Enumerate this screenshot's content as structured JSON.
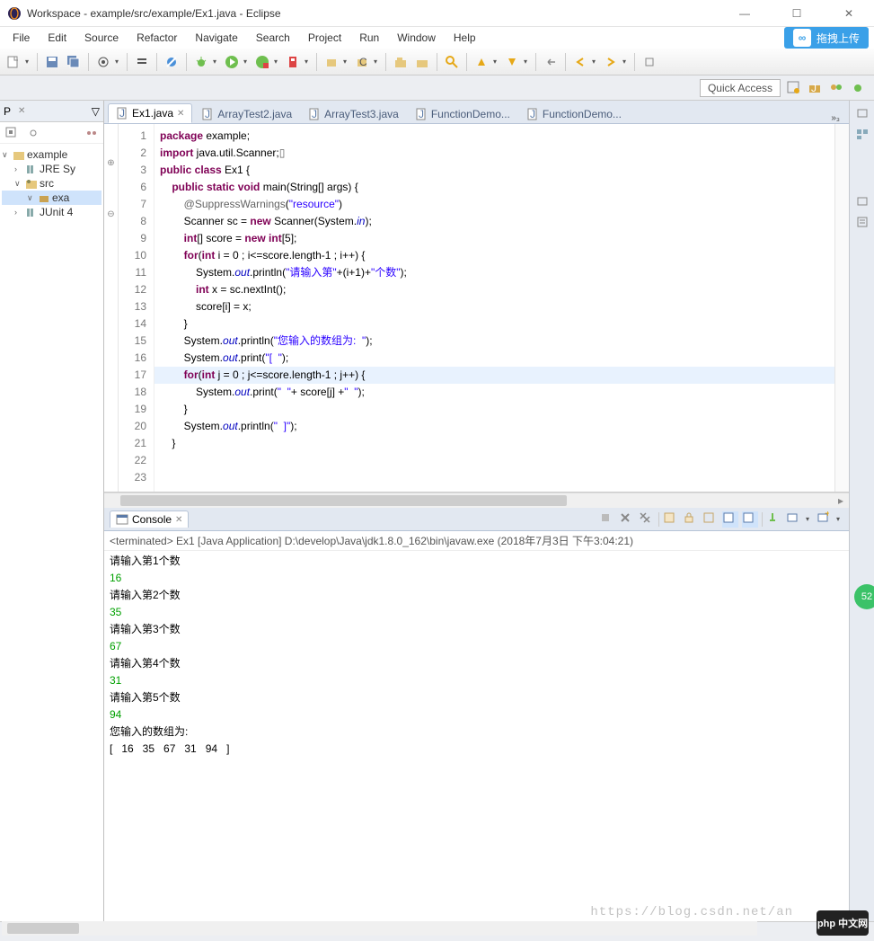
{
  "window": {
    "title": "Workspace - example/src/example/Ex1.java - Eclipse"
  },
  "menu": [
    "File",
    "Edit",
    "Source",
    "Refactor",
    "Navigate",
    "Search",
    "Project",
    "Run",
    "Window",
    "Help"
  ],
  "upload_label": "拖拽上传",
  "quick_access": "Quick Access",
  "sidebar": {
    "tab_label": "P",
    "tree": {
      "root": "example",
      "jre": "JRE Sy",
      "src": "src",
      "pkg": "exa",
      "junit": "JUnit 4"
    }
  },
  "editor": {
    "tabs": [
      {
        "label": "Ex1.java",
        "active": true,
        "close": true
      },
      {
        "label": "ArrayTest2.java",
        "active": false
      },
      {
        "label": "ArrayTest3.java",
        "active": false
      },
      {
        "label": "FunctionDemo...",
        "active": false
      },
      {
        "label": "FunctionDemo...",
        "active": false
      }
    ],
    "overflow": "»₃",
    "highlight_line": 17,
    "lines": [
      {
        "n": 1,
        "t": [
          [
            "kw",
            "package"
          ],
          [
            "",
            " example;"
          ]
        ]
      },
      {
        "n": 2,
        "t": [
          [
            "",
            ""
          ]
        ]
      },
      {
        "n": 3,
        "mk": "⊕",
        "t": [
          [
            "kw",
            "import"
          ],
          [
            "",
            " java.util.Scanner;"
          ],
          [
            "cm",
            "▯"
          ]
        ]
      },
      {
        "n": 6,
        "t": [
          [
            "",
            ""
          ]
        ]
      },
      {
        "n": 7,
        "t": [
          [
            "kw",
            "public class"
          ],
          [
            "",
            " Ex1 {"
          ]
        ]
      },
      {
        "n": 8,
        "mk": "⊖",
        "t": [
          [
            "",
            "    "
          ],
          [
            "kw",
            "public static void"
          ],
          [
            "",
            " main(String[] args) {"
          ]
        ]
      },
      {
        "n": 9,
        "t": [
          [
            "",
            "        "
          ],
          [
            "ann",
            "@SuppressWarnings"
          ],
          [
            "",
            "("
          ],
          [
            "str",
            "\"resource\""
          ],
          [
            "",
            ")"
          ]
        ]
      },
      {
        "n": 10,
        "t": [
          [
            "",
            "        Scanner sc = "
          ],
          [
            "kw",
            "new"
          ],
          [
            "",
            " Scanner(System."
          ],
          [
            "fld",
            "in"
          ],
          [
            "",
            ");"
          ]
        ]
      },
      {
        "n": 11,
        "t": [
          [
            "",
            "        "
          ],
          [
            "kw",
            "int"
          ],
          [
            "",
            "[] score = "
          ],
          [
            "kw",
            "new int"
          ],
          [
            "",
            "[5];"
          ]
        ]
      },
      {
        "n": 12,
        "t": [
          [
            "",
            "        "
          ],
          [
            "kw",
            "for"
          ],
          [
            "",
            "("
          ],
          [
            "kw",
            "int"
          ],
          [
            "",
            " i = 0 ; i<=score.length-1 ; i++) {"
          ]
        ]
      },
      {
        "n": 13,
        "t": [
          [
            "",
            "            System."
          ],
          [
            "fld",
            "out"
          ],
          [
            "",
            ".println("
          ],
          [
            "str",
            "\"请输入第\""
          ],
          [
            "",
            "+(i+1)+"
          ],
          [
            "str",
            "\"个数\""
          ],
          [
            "",
            ");"
          ]
        ]
      },
      {
        "n": 14,
        "t": [
          [
            "",
            "            "
          ],
          [
            "kw",
            "int"
          ],
          [
            "",
            " x = sc.nextInt();"
          ]
        ]
      },
      {
        "n": 15,
        "t": [
          [
            "",
            "            score[i] = x;"
          ]
        ]
      },
      {
        "n": 16,
        "t": [
          [
            "",
            "        }"
          ]
        ]
      },
      {
        "n": 17,
        "t": [
          [
            "",
            "        System."
          ],
          [
            "fld",
            "out"
          ],
          [
            "",
            ".println("
          ],
          [
            "str",
            "\"您输入的数组为:  \""
          ],
          [
            "",
            ");"
          ]
        ]
      },
      {
        "n": 18,
        "t": [
          [
            "",
            "        System."
          ],
          [
            "fld",
            "out"
          ],
          [
            "",
            ".print("
          ],
          [
            "str",
            "\"[  \""
          ],
          [
            "",
            ");"
          ]
        ]
      },
      {
        "n": 19,
        "t": [
          [
            "",
            "        "
          ],
          [
            "kw",
            "for"
          ],
          [
            "",
            "("
          ],
          [
            "kw",
            "int"
          ],
          [
            "",
            " j = 0 ; j<=score.length-1 ; j++) {"
          ]
        ]
      },
      {
        "n": 20,
        "t": [
          [
            "",
            "            System."
          ],
          [
            "fld",
            "out"
          ],
          [
            "",
            ".print("
          ],
          [
            "str",
            "\"  \""
          ],
          [
            "",
            "+ score[j] +"
          ],
          [
            "str",
            "\"  \""
          ],
          [
            "",
            ");"
          ]
        ]
      },
      {
        "n": 21,
        "t": [
          [
            "",
            "        }"
          ]
        ]
      },
      {
        "n": 22,
        "t": [
          [
            "",
            "        System."
          ],
          [
            "fld",
            "out"
          ],
          [
            "",
            ".println("
          ],
          [
            "str",
            "\"  ]\""
          ],
          [
            "",
            ");"
          ]
        ]
      },
      {
        "n": 23,
        "t": [
          [
            "",
            "    }"
          ]
        ]
      }
    ]
  },
  "console": {
    "tab": "Console",
    "info": "<terminated> Ex1 [Java Application] D:\\develop\\Java\\jdk1.8.0_162\\bin\\javaw.exe (2018年7月3日 下午3:04:21)",
    "lines": [
      {
        "c": "",
        "t": "请输入第1个数"
      },
      {
        "c": "co-input",
        "t": "16"
      },
      {
        "c": "",
        "t": "请输入第2个数"
      },
      {
        "c": "co-input",
        "t": "35"
      },
      {
        "c": "",
        "t": "请输入第3个数"
      },
      {
        "c": "co-input",
        "t": "67"
      },
      {
        "c": "",
        "t": "请输入第4个数"
      },
      {
        "c": "co-input",
        "t": "31"
      },
      {
        "c": "",
        "t": "请输入第5个数"
      },
      {
        "c": "co-input",
        "t": "94"
      },
      {
        "c": "",
        "t": "您输入的数组为:  "
      },
      {
        "c": "",
        "t": "[   16   35   67   31   94   ]"
      }
    ]
  },
  "watermark": "https://blog.csdn.net/an",
  "php_logo": "php 中文网",
  "badge": "52"
}
